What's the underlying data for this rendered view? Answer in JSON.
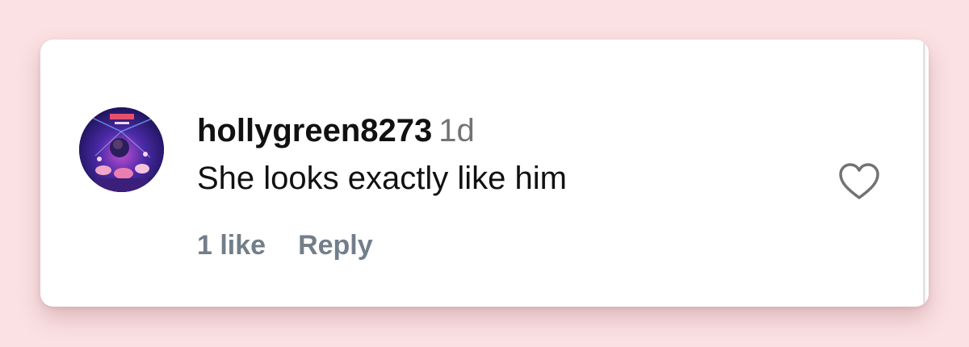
{
  "comment": {
    "username": "hollygreen8273",
    "timestamp": "1d",
    "text": "She looks exactly like him",
    "likes_label": "1 like",
    "reply_label": "Reply"
  },
  "icons": {
    "avatar": "user-avatar",
    "like": "heart-outline-icon"
  },
  "colors": {
    "background": "#fbe1e3",
    "card": "#ffffff",
    "primary_text": "#111111",
    "secondary_text": "#737373",
    "action_text": "#737e8a"
  }
}
